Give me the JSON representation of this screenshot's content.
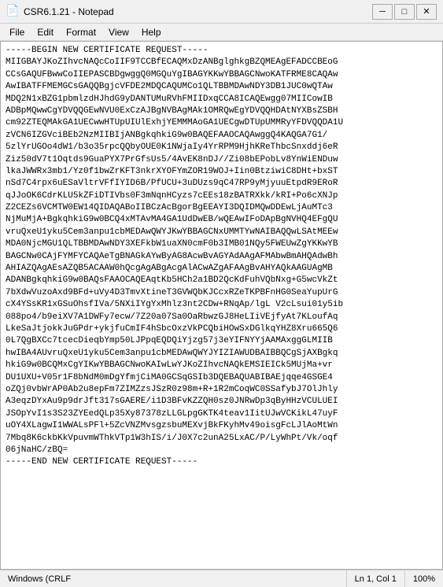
{
  "titleBar": {
    "title": "CSR6.1.21 - Notepad",
    "icon": "📄",
    "minimizeLabel": "─",
    "maximizeLabel": "□",
    "closeLabel": "✕"
  },
  "menuBar": {
    "items": [
      "File",
      "Edit",
      "Format",
      "View",
      "Help"
    ]
  },
  "content": {
    "text": "-----BEGIN NEW CERTIFICATE REQUEST-----\nMIIGBAYJKoZIhvcNAQcCoIIF9TCCBfECAQMxDzANBglghkgBZQMEAgEFADCCBEoG\nCCsGAQUFBwwCoIIEPASCBDgwggQ0MGQuYgIBAGYKKwYBBAGCNwoKATFRME8CAQAw\nAwIBATFFMEMGCsGAQQBgjcVFDE2MDQCAQUMCo1QLTBBMDAwNDY3DB1JUC0wQTAw\nMDQ2N1xBZG1pbmlzdHJhdG9yDANTUMuRVhFMIIDxqCCA8ICAQEwgg07MIICowIB\nADBpMQwwCgYDVQQGEwNVU0ExCzAJBgNVBAgMAk1OMRQwEgYDVQQHDAtNYXBsZSBH\ncm92ZTEQMAkGA1UECwwHTUpUIUlExhjYEMMMAoGA1UECgwDTUpUMMRyYFDVQQDA1U\nzVCN6IZGVciBEb2NzMIIBIjANBgkqhkiG9w0BAQEFAAOCAQAwggQ4KAQGA7G1/\n5zlYrUGOo4dW1/b3o35rpcQQbyOUE0K1NWjaIy4YrRPM9HjhKReThbcSnxddj6eR\nZiz50dV7t1Oqtds9GuaPYX7PrGfsUs5/4AvEK8nDJ//Zi08bEPobLv8YnWiENDuw\nlkaJWWRx3mb1/Yz0f1bwZrKFT3nkrXYOFYmZOR19WOJ+Iin0BtziwiC8DHt+bxST\nnSd7C4rpx6uESaVltrVFfIYID6B/PfUCU+3uDUzs9qC47RP9yMjyuuEtpdR9ERoR\nqJJoOK6CdrKLU5kZFiDTIVbs0F3mNqnHCyzs7cEEs18zBATRXkk/kRI+Po6cXNJp\nZ2CEZs6VCMTW0EW14QIDAQABoIIBCzAcBgorBgEEAYI3DQIDMQwDDEwLjAuMTc3\nNjMuMjA+BgkqhkiG9w0BCQ4xMTAvMA4GA1UdDwEB/wQEAwIFoDApBgNVHQ4EFgQU\nvruQxeU1yku5Cem3anpu1cbMEDAwQWYJKwYBBAGCNxUMMTYwNAIBAQQwLSAtMEEw\nMDA0NjcMGU1QLTBBMDAwNDY3XEFkbW1uaXN0cmF0b3IMB01NQy5FWEUwZgYKKwYB\nBAGCNw0CAjFYMFYCAQAeTgBNAGkAYwByAG8AcwBvAGYAdAAgAFMAbwBmAHQAdwBh\nAHIAZQAgAEsAZQB5ACAAW0hQcgAgABgAcgAlACwAZgAFAAgBvAHYAQkAAGUAgMB\nADANBgkqhkiG9w0BAQsFAAOCAQEAqtKb5HCh2a1BD2QcKdFuhVQbNxg+G5wcVkZt\n7bXdwVuzoAxd9BFd+uVy4D3TmvXtineT3GVWQbKJCcxRZeTKPBFnHG0SeaYupUrG\ncX4YSsKR1xGSuOhsfIVa/5NXiIYgYxMhlz3nt2CDw+RNqAp/lgL V2cLsui01y5ib\n088po4/b9eiXV7A1DWFy7ecw/7Z20a07Sa0OaRbwzGJ8HeLIiVEjfyAt7KLoufAq\nLkeSaJtjokkJuGPdr+ykjfuCmIF4hSbcOxzVkPCQbiHOwSxDGlkqYHZ8Xru665Q6\n0L7QgBXCc7tcecDieqbYmp50LJPpqEQDQiYjzg57j3eYIFNYYjAAMAxggGLMIIB\nhwIBA4AUvruQxeU1yku5Cem3anpu1cbMEDAwQWYJYIZIAWUDBAIBBQCgSjAXBgkq\nhkiG9w0BCQMxCgYIKwYBBAGCNwoKAIwLwYJKoZIhvcNAQkEMSIEICk5MUjMa+vr\nDU1UXU+V05r1F8bNdM0mDgYfmjCiMA0GCSqGSIb3DQEBAQUABIBAEjqqe4GSGE4\noZQj0vbWrAP0Ab2u8epFm7ZIMZzsJSzR0z98m+R+1R2mCoqWC0SSafybJ7OlJhly\nA3eqzDYxAu9p9drJft317sGAERE/i1D3BFvKZZQH0sz0JNRwDp3qByHHzVCULUEI\nJSOpYvI1s3S23ZYEedQLp35Xy87378zLLGLpgGKTK4teav1IitUJwVCKikL47uyF\nuOY4XLagwI1WWALsPFl+5ZcVNZMvsgzsbuMEXvjBkFKyhMv49oisgFcLJlAoMtWn\n7Mbq8K6ckbKkVpuvmWThkVTp1W3hIS/i/J0X7c2unA25LxAC/P/LyWhPt/Vk/oqf\n06jNaHC/zBQ=\n-----END NEW CERTIFICATE REQUEST-----"
  },
  "statusBar": {
    "windows": "Windows (CRLF",
    "position": "Ln 1, Col 1",
    "zoom": "100%"
  }
}
